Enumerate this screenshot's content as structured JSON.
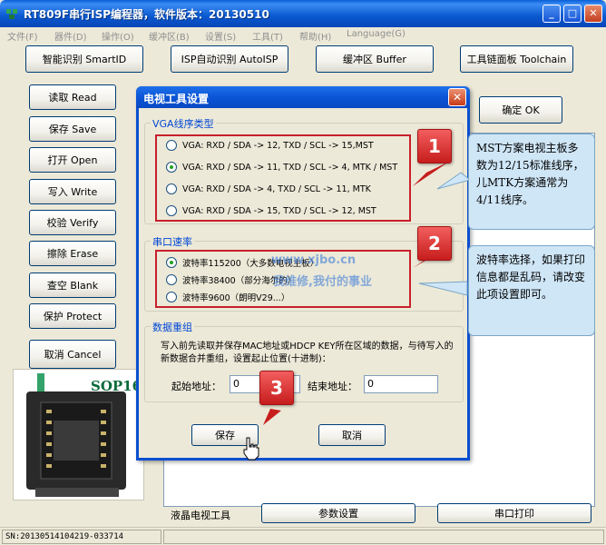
{
  "window": {
    "title": "RT809F串行ISP编程器，软件版本：20130510",
    "min_label": "_",
    "max_label": "□",
    "close_label": "✕"
  },
  "menu": [
    "文件(F)",
    "器件(D)",
    "操作(O)",
    "缓冲区(B)",
    "设置(S)",
    "工具(T)",
    "帮助(H)",
    "Language(G)"
  ],
  "toolbar": {
    "smart_id": "智能识别 SmartID",
    "isp_auto": "ISP自动识别 AutoISP",
    "buffer": "缓冲区 Buffer",
    "toolchain": "工具链面板 Toolchain",
    "ok": "确定 OK"
  },
  "left_buttons": [
    "读取 Read",
    "保存 Save",
    "打开 Open",
    "写入 Write",
    "校验 Verify",
    "擦除 Erase",
    "查空 Blank",
    "保护 Protect",
    "取消 Cancel"
  ],
  "chip": {
    "label": "SOP16"
  },
  "bottom": {
    "tv_tool_label": "液晶电视工具",
    "params_button": "参数设置",
    "serial_print_button": "串口打印"
  },
  "status": {
    "sn": "SN:20130514104219-033714"
  },
  "dialog": {
    "title": "电视工具设置",
    "close_label": "✕",
    "vga_group": {
      "legend": "VGA线序类型",
      "options": [
        "VGA: RXD / SDA -> 12, TXD / SCL -> 15,MST",
        "VGA: RXD / SDA -> 11, TXD / SCL ->  4, MTK / MST",
        "VGA: RXD / SDA ->  4, TXD / SCL -> 11, MTK",
        "VGA: RXD / SDA -> 15, TXD / SCL -> 12, MST"
      ],
      "selected_index": 1
    },
    "baud_group": {
      "legend": "串口速率",
      "options": [
        "波特率115200（大多数电视主板）",
        "波特率38400（部分海尔的）",
        "波特率9600（朗明V29...）"
      ],
      "selected_index": 0
    },
    "data_group": {
      "legend": "数据重组",
      "description": "写入前先读取并保存MAC地址或HDCP KEY所在区域的数据，与待写入的新数据合并重组，设置起止位置(十进制)：",
      "start_label": "起始地址：",
      "start_value": "0",
      "end_label": "结束地址：",
      "end_value": "0"
    },
    "save_button": "保存",
    "cancel_button": "取消",
    "watermark_url": "www.xjbo.cn",
    "watermark_slogan": "我维修,我付的事业"
  },
  "callouts": [
    {
      "number": "1",
      "text": "MST方案电视主板多数为12/15标准线序，儿MTK方案通常为4/11线序。"
    },
    {
      "number": "2",
      "text": "波特率选择，如果打印信息都是乱码，请改变此项设置即可。"
    },
    {
      "number": "3"
    }
  ],
  "colors": {
    "title_blue": "#0a58d0",
    "callout_red": "#c71d1d",
    "bubble_blue": "#cfe6f7",
    "group_blue": "#0046d5"
  }
}
